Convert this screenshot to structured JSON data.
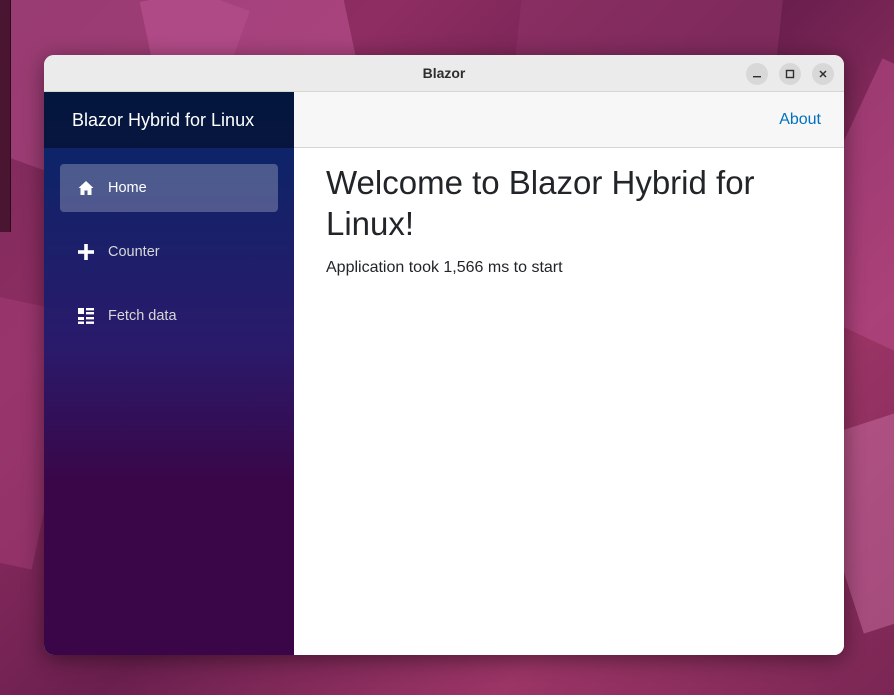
{
  "window": {
    "title": "Blazor"
  },
  "sidebar": {
    "brand": "Blazor Hybrid for Linux",
    "items": [
      {
        "label": "Home",
        "icon": "home-icon",
        "active": true
      },
      {
        "label": "Counter",
        "icon": "plus-icon",
        "active": false
      },
      {
        "label": "Fetch data",
        "icon": "list-icon",
        "active": false
      }
    ]
  },
  "top_row": {
    "about_label": "About"
  },
  "main": {
    "heading": "Welcome to Blazor Hybrid for Linux!",
    "startup_text": "Application took 1,566 ms to start"
  },
  "colors": {
    "link": "#0071c1",
    "sidebar_top": "#052767",
    "sidebar_bottom": "#3a0647"
  }
}
